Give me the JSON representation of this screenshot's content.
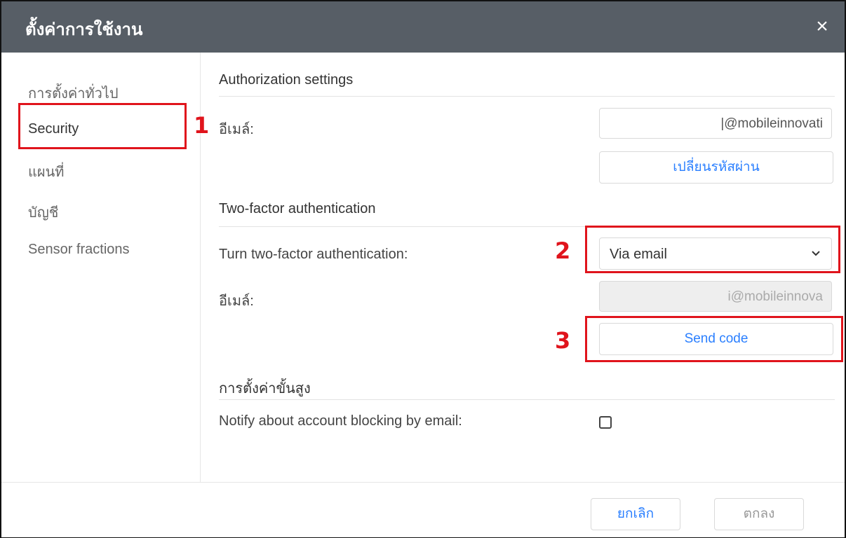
{
  "dialog": {
    "title": "ตั้งค่าการใช้งาน",
    "close": "×"
  },
  "sidebar": {
    "items": [
      {
        "label": "การตั้งค่าทั่วไป"
      },
      {
        "label": "Security"
      },
      {
        "label": "แผนที่"
      },
      {
        "label": "บัญชี"
      },
      {
        "label": "Sensor fractions"
      }
    ]
  },
  "authorization": {
    "title": "Authorization settings",
    "email_label": "อีเมล์:",
    "email_value": "|@mobileinnovati",
    "change_password": "เปลี่ยนรหัสผ่าน"
  },
  "two_factor": {
    "title": "Two-factor authentication",
    "turn_label": "Turn two-factor authentication:",
    "turn_value": "Via email",
    "email_label": "อีเมล์:",
    "email_value": "i@mobileinnova",
    "send_code": "Send code"
  },
  "advanced": {
    "title": "การตั้งค่าขั้นสูง",
    "notify_label": "Notify about account blocking by email:",
    "notify_checked": false
  },
  "footer": {
    "cancel": "ยกเลิก",
    "ok": "ตกลง"
  },
  "annotations": {
    "n1": "1",
    "n2": "2",
    "n3": "3",
    "color": "#e0141c"
  },
  "colors": {
    "titlebar": "#575e66",
    "link": "#2a7fff"
  }
}
